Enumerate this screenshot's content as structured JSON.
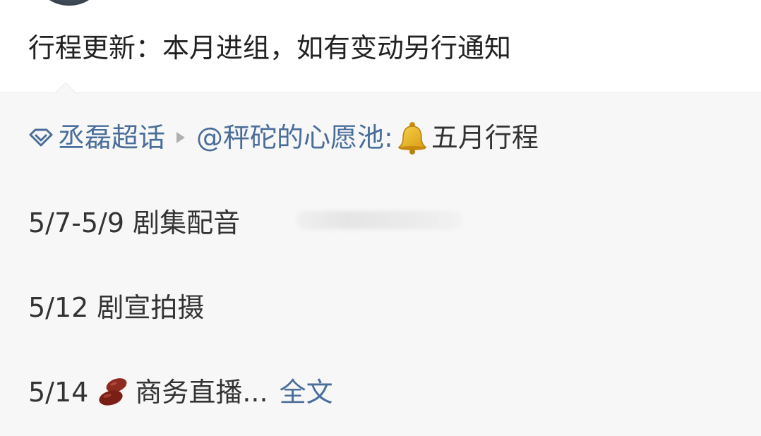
{
  "post": {
    "text": "行程更新：本月进组，如有变动另行通知"
  },
  "repost": {
    "topic": "丞磊超话",
    "mention": "@秤砣的心愿池:",
    "title": "五月行程",
    "lines": [
      {
        "text": "5/7-5/9 剧集配音"
      },
      {
        "text": "5/12 剧宣拍摄"
      },
      {
        "date": "5/14",
        "text": "商务直播...",
        "more": "全文"
      }
    ]
  },
  "icons": {
    "topic": "diamond-icon",
    "separator": "triangle-right-icon",
    "bell": "bell-icon",
    "bean": "bean-icon"
  },
  "colors": {
    "link": "#4a6e9a",
    "text": "#333333",
    "repost_bg": "#f7f7f7"
  }
}
